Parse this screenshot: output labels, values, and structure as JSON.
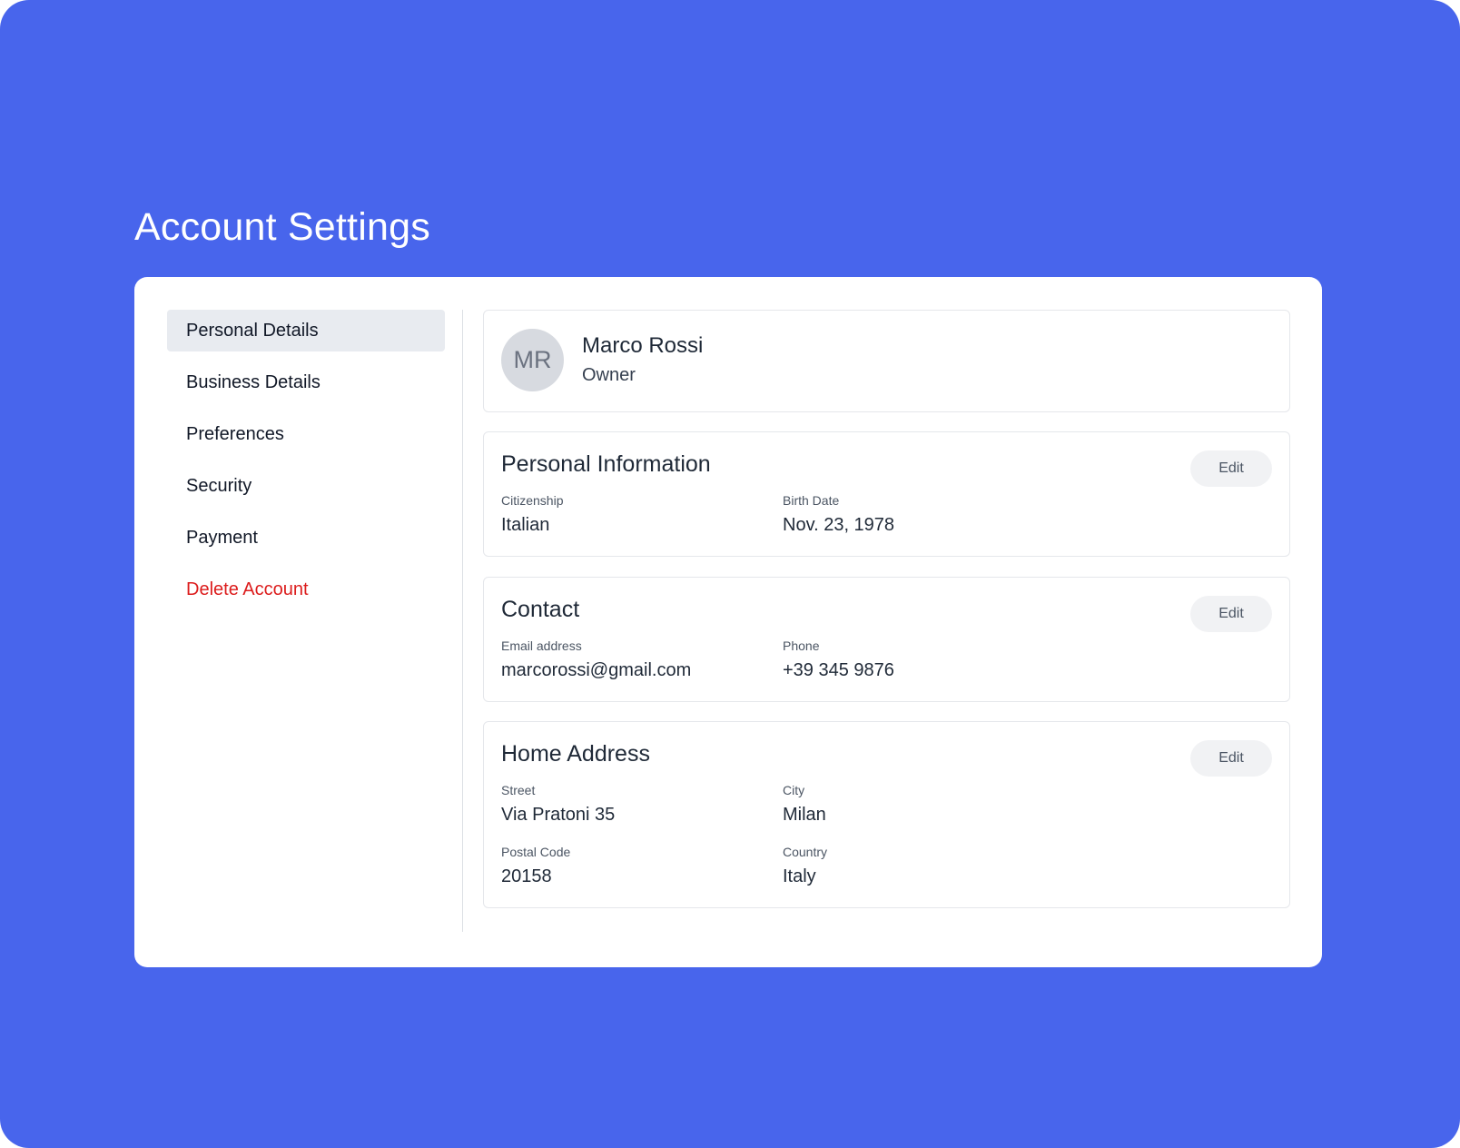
{
  "page": {
    "title": "Account Settings"
  },
  "sidebar": {
    "items": [
      {
        "label": "Personal Details"
      },
      {
        "label": "Business Details"
      },
      {
        "label": "Preferences"
      },
      {
        "label": "Security"
      },
      {
        "label": "Payment"
      },
      {
        "label": "Delete Account"
      }
    ]
  },
  "profile": {
    "initials": "MR",
    "name": "Marco Rossi",
    "role": "Owner"
  },
  "personal_info": {
    "title": "Personal Information",
    "edit_label": "Edit",
    "fields": [
      {
        "label": "Citizenship",
        "value": "Italian"
      },
      {
        "label": "Birth Date",
        "value": "Nov. 23, 1978"
      }
    ]
  },
  "contact": {
    "title": "Contact",
    "edit_label": "Edit",
    "fields": [
      {
        "label": "Email address",
        "value": "marcorossi@gmail.com"
      },
      {
        "label": "Phone",
        "value": "+39 345 9876"
      }
    ]
  },
  "home_address": {
    "title": "Home Address",
    "edit_label": "Edit",
    "fields": [
      {
        "label": "Street",
        "value": "Via Pratoni 35"
      },
      {
        "label": "City",
        "value": "Milan"
      },
      {
        "label": "Postal Code",
        "value": "20158"
      },
      {
        "label": "Country",
        "value": "Italy"
      }
    ]
  },
  "colors": {
    "background": "#4865ec",
    "danger": "#dc1c1c",
    "active_nav": "#e8ebf0",
    "avatar": "#d7dae0"
  }
}
